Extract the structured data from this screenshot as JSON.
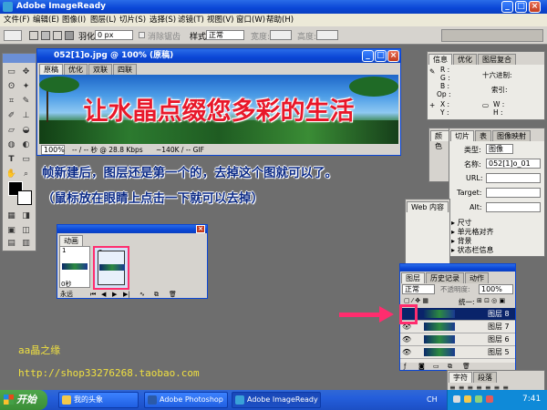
{
  "app": {
    "title": "Adobe ImageReady"
  },
  "menu": [
    "文件(F)",
    "编辑(E)",
    "图像(I)",
    "图层(L)",
    "切片(S)",
    "选择(S)",
    "滤镜(T)",
    "视图(V)",
    "窗口(W)",
    "帮助(H)"
  ],
  "options": {
    "feather_label": "羽化:",
    "feather_value": "0 px",
    "antialias_label": "消除锯齿",
    "style_label": "样式:",
    "style_value": "正常",
    "width_label": "宽度:",
    "height_label": "高度:"
  },
  "doc": {
    "title": "052[1]o.jpg @ 100% (原稿)",
    "tabs": [
      "原稿",
      "优化",
      "双联",
      "四联"
    ],
    "banner_text": "让水晶点缀您多彩的生活",
    "status_zoom": "100%",
    "status_speed": "-- / -- 秒 @ 28.8 Kbps",
    "status_size": "~140K / -- GIF"
  },
  "instructions": {
    "line1": "帧新建后，图层还是第一个的，去掉这个图就可以了。",
    "line2": "（鼠标放在眼睛上点击一下就可以去掉）"
  },
  "animation": {
    "title": "动画",
    "frames": [
      {
        "num": "1",
        "delay": "0秒"
      },
      {
        "num": "2",
        "delay": "0秒"
      }
    ],
    "loop": "永远"
  },
  "info_panel": {
    "tabs": [
      "信息",
      "优化",
      "图层复合"
    ],
    "rgb_labels": [
      "R :",
      "G :",
      "B :",
      "Op :"
    ],
    "x_label": "X :",
    "y_label": "Y :",
    "hex_label": "十六进制:",
    "index_label": "索引:",
    "w_label": "W :",
    "h_label": "H :"
  },
  "slice_panel": {
    "tabs": [
      "切片",
      "表",
      "图像映射"
    ],
    "type_label": "类型:",
    "type_value": "图像",
    "name_label": "名称:",
    "name_value": "052[1]o_01",
    "url_label": "URL:",
    "target_label": "Target:",
    "alt_label": "Alt:",
    "sections": [
      "尺寸",
      "单元格对齐",
      "背景",
      "状态栏信息"
    ]
  },
  "web_panel": {
    "tabs": [
      "Web 内容",
      "颜"
    ]
  },
  "colors_tab": "颜色",
  "layers_panel": {
    "tabs": [
      "图层",
      "历史记录",
      "动作"
    ],
    "mode": "正常",
    "opacity_label": "不透明度:",
    "opacity_value": "100%",
    "unify_label": "统一:",
    "layers": [
      {
        "name": "图层 8",
        "selected": true,
        "eye": false
      },
      {
        "name": "图层 7",
        "selected": false,
        "eye": true
      },
      {
        "name": "图层 6",
        "selected": false,
        "eye": true
      },
      {
        "name": "图层 5",
        "selected": false,
        "eye": true
      }
    ]
  },
  "char_panel": {
    "tabs": [
      "字符",
      "段落"
    ]
  },
  "watermark": {
    "line1": "aa晶之缘",
    "line2": "http://shop33276268.taobao.com"
  },
  "taskbar": {
    "start": "开始",
    "buttons": [
      "我的头象",
      "Adobe Photoshop",
      "Adobe ImageReady"
    ],
    "lang": "CH",
    "time": "7:41"
  },
  "accent_colors": {
    "highlight": "#ff2d6e",
    "titlebar": "#0a46d6",
    "instructions": "#0b2a86"
  }
}
